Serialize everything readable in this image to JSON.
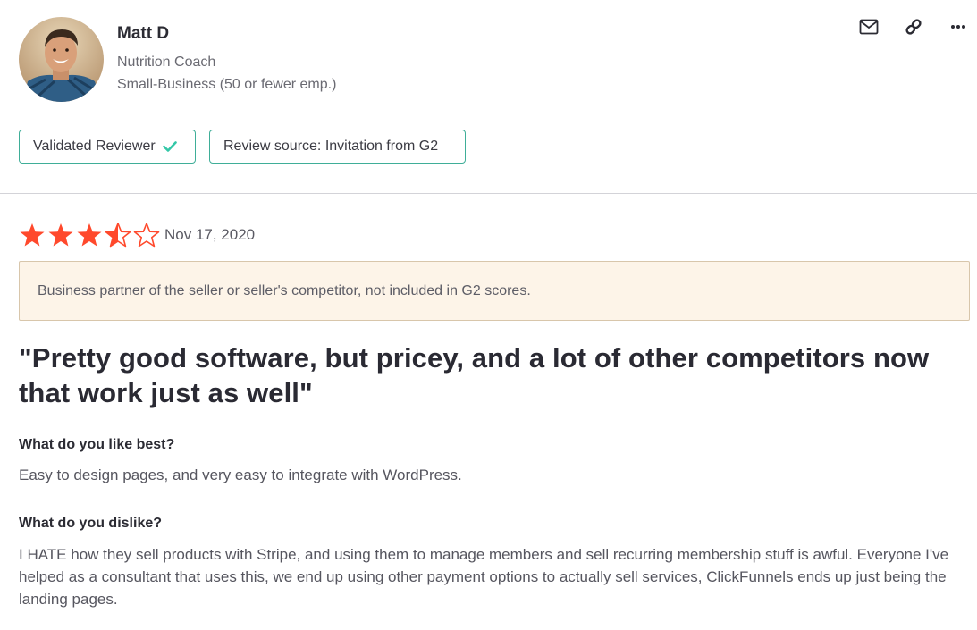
{
  "reviewer": {
    "name": "Matt D",
    "role": "Nutrition Coach",
    "company_size": "Small-Business (50 or fewer emp.)"
  },
  "actions": {
    "icons": [
      "mail-icon",
      "link-icon",
      "more-icon"
    ]
  },
  "badges": {
    "validated_label": "Validated Reviewer",
    "source_label": "Review source: Invitation from G2"
  },
  "review": {
    "rating": 3.5,
    "rating_max": 5,
    "date": "Nov 17, 2020",
    "notice": "Business partner of the seller or seller's competitor, not included in G2 scores.",
    "headline": "\"Pretty good software, but pricey, and a lot of other competitors now that work just as well\"",
    "questions": [
      {
        "label": "What do you like best?",
        "answer": "Easy to design pages, and very easy to integrate with WordPress."
      },
      {
        "label": "What do you dislike?",
        "answer": "I HATE how they sell products with Stripe, and using them to manage members and sell recurring membership stuff is awful. Everyone I've helped as a consultant that uses this, we end up using other payment options to actually sell services, ClickFunnels ends up just being the landing pages."
      }
    ]
  },
  "colors": {
    "star": "#ff492c",
    "badge_border": "#3fae98",
    "check": "#33c7a7",
    "notice_bg": "#fdf4e8"
  }
}
